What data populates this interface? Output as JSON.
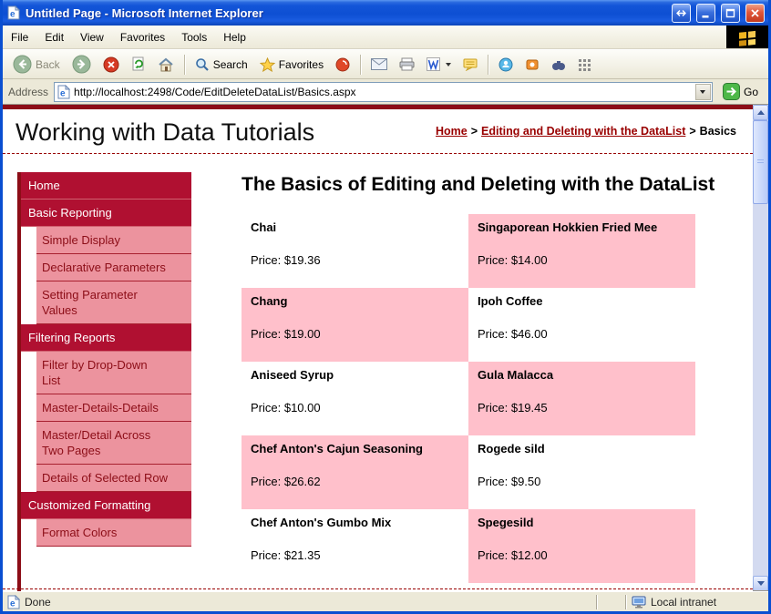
{
  "window": {
    "title": "Untitled Page - Microsoft Internet Explorer",
    "menus": [
      "File",
      "Edit",
      "View",
      "Favorites",
      "Tools",
      "Help"
    ],
    "buttons": [
      "resize",
      "minimize",
      "maximize",
      "close"
    ],
    "toolbar": {
      "back_label": "Back",
      "search_label": "Search",
      "favorites_label": "Favorites",
      "icons": [
        "back",
        "forward",
        "stop",
        "refresh",
        "home",
        "search",
        "favorites",
        "media",
        "mail",
        "print",
        "edit-word",
        "discuss",
        "messenger",
        "snagit",
        "binoculars",
        "quick-links"
      ]
    },
    "address": {
      "label": "Address",
      "url": "http://localhost:2498/Code/EditDeleteDataList/Basics.aspx",
      "go_label": "Go"
    },
    "status": {
      "done": "Done",
      "zone": "Local intranet"
    }
  },
  "page": {
    "site_title": "Working with Data Tutorials",
    "breadcrumb": {
      "home": "Home",
      "section": "Editing and Deleting with the DataList",
      "current": "Basics",
      "separator": ">"
    },
    "sidebar": [
      {
        "label": "Home",
        "type": "section"
      },
      {
        "label": "Basic Reporting",
        "type": "section"
      },
      {
        "label": "Simple Display",
        "type": "item"
      },
      {
        "label": "Declarative Parameters",
        "type": "item"
      },
      {
        "label": "Setting Parameter Values",
        "type": "item"
      },
      {
        "label": "Filtering Reports",
        "type": "section"
      },
      {
        "label": "Filter by Drop-Down List",
        "type": "item"
      },
      {
        "label": "Master-Details-Details",
        "type": "item"
      },
      {
        "label": "Master/Detail Across Two Pages",
        "type": "item"
      },
      {
        "label": "Details of Selected Row",
        "type": "item"
      },
      {
        "label": "Customized Formatting",
        "type": "section"
      },
      {
        "label": "Format Colors",
        "type": "item"
      }
    ],
    "heading": "The Basics of Editing and Deleting with the DataList",
    "products": [
      {
        "name": "Chai",
        "price_text": "Price: $19.36",
        "alt": false
      },
      {
        "name": "Singaporean Hokkien Fried Mee",
        "price_text": "Price: $14.00",
        "alt": true
      },
      {
        "name": "Chang",
        "price_text": "Price: $19.00",
        "alt": true
      },
      {
        "name": "Ipoh Coffee",
        "price_text": "Price: $46.00",
        "alt": false
      },
      {
        "name": "Aniseed Syrup",
        "price_text": "Price: $10.00",
        "alt": false
      },
      {
        "name": "Gula Malacca",
        "price_text": "Price: $19.45",
        "alt": true
      },
      {
        "name": "Chef Anton's Cajun Seasoning",
        "price_text": "Price: $26.62",
        "alt": true
      },
      {
        "name": "Rogede sild",
        "price_text": "Price: $9.50",
        "alt": false
      },
      {
        "name": "Chef Anton's Gumbo Mix",
        "price_text": "Price: $21.35",
        "alt": false
      },
      {
        "name": "Spegesild",
        "price_text": "Price: $12.00",
        "alt": true
      }
    ]
  },
  "colors": {
    "maroon_dark": "#8c0d17",
    "section_bg": "#b01031",
    "sidebar_pink": "#ec939e",
    "list_pink": "#ffc0cb",
    "link": "#990000",
    "xp_blue": "#0a4fd1",
    "go_green": "#4db848"
  }
}
